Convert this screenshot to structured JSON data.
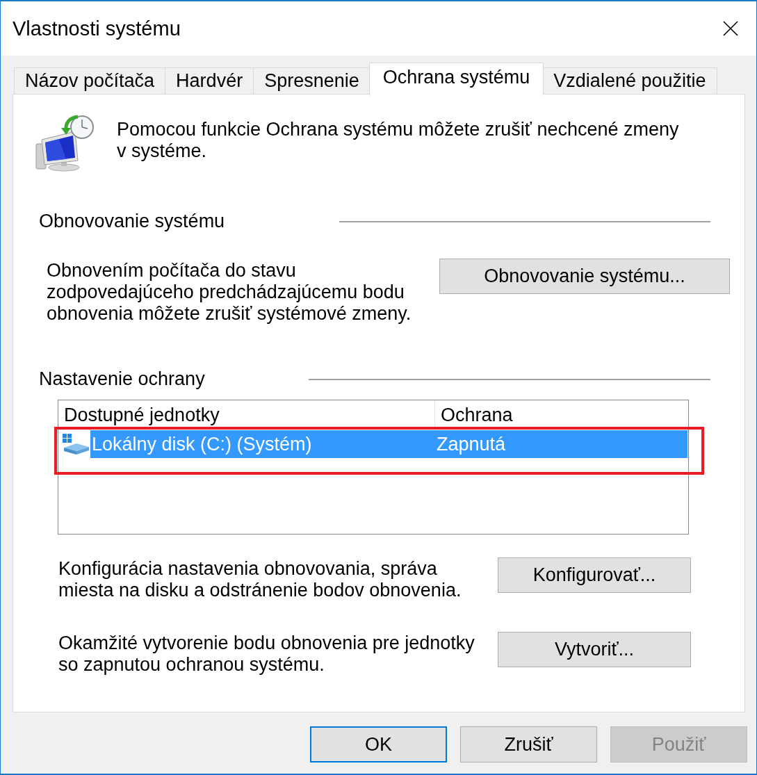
{
  "window": {
    "title": "Vlastnosti systému"
  },
  "tabs": [
    {
      "label": "Názov počítača",
      "selected": false
    },
    {
      "label": "Hardvér",
      "selected": false
    },
    {
      "label": "Spresnenie",
      "selected": false
    },
    {
      "label": "Ochrana systému",
      "selected": true
    },
    {
      "label": "Vzdialené použitie",
      "selected": false
    }
  ],
  "intro": {
    "lines": [
      "Pomocou funkcie Ochrana systému môžete zrušiť nechcené zmeny",
      "v systéme."
    ]
  },
  "restore_section": {
    "heading": "Obnovovanie systému",
    "description": [
      "Obnovením počítača do stavu",
      "zodpovedajúceho predchádzajúcemu bodu",
      "obnovenia môžete zrušiť systémové zmeny."
    ],
    "button": "Obnovovanie systému..."
  },
  "protection_section": {
    "heading": "Nastavenie ochrany",
    "drives": {
      "columns": [
        "Dostupné jednotky",
        "Ochrana"
      ],
      "rows": [
        {
          "name": "Lokálny disk (C:) (Systém)",
          "protection": "Zapnutá",
          "selected": true,
          "highlighted": true
        }
      ]
    },
    "actions": [
      {
        "description": [
          "Konfigurácia nastavenia obnovovania, správa",
          "miesta na disku a odstránenie bodov obnovenia."
        ],
        "button": "Konfigurovať..."
      },
      {
        "description": [
          "Okamžité vytvorenie bodu obnovenia pre jednotky",
          "so zapnutou ochranou systému."
        ],
        "button": "Vytvoriť..."
      }
    ]
  },
  "buttons": [
    {
      "label": "OK",
      "default": true,
      "disabled": false
    },
    {
      "label": "Zrušiť",
      "default": false,
      "disabled": false
    },
    {
      "label": "Použiť",
      "default": false,
      "disabled": true
    }
  ]
}
